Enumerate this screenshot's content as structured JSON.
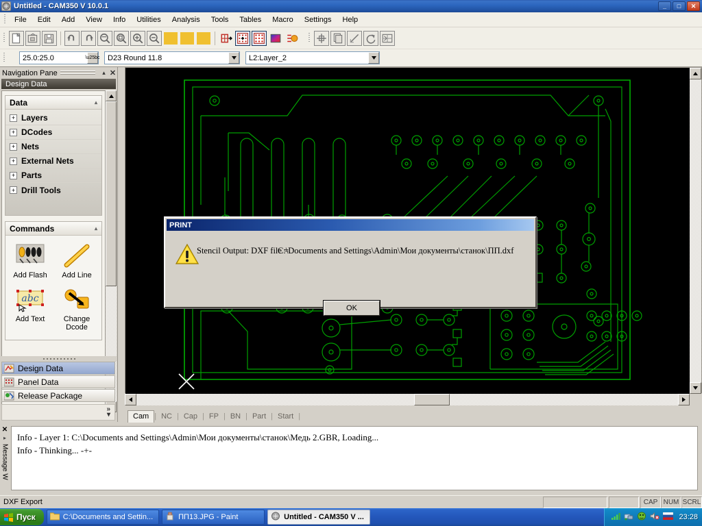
{
  "window": {
    "title": "Untitled - CAM350 V 10.0.1",
    "app_icon": "cam350-app-icon",
    "minimize": "_",
    "maximize": "□",
    "close": "✕"
  },
  "menubar": {
    "items": [
      {
        "label": "File"
      },
      {
        "label": "Edit"
      },
      {
        "label": "Add"
      },
      {
        "label": "View"
      },
      {
        "label": "Info"
      },
      {
        "label": "Utilities"
      },
      {
        "label": "Analysis"
      },
      {
        "label": "Tools"
      },
      {
        "label": "Tables"
      },
      {
        "label": "Macro"
      },
      {
        "label": "Settings"
      },
      {
        "label": "Help"
      }
    ]
  },
  "toolbar": {
    "buttons": [
      {
        "name": "new-file-icon"
      },
      {
        "name": "open-file-icon"
      },
      {
        "name": "save-file-icon"
      },
      {
        "name": "undo-icon"
      },
      {
        "name": "redo-icon"
      },
      {
        "name": "zoom-window-icon"
      },
      {
        "name": "zoom-extents-icon"
      },
      {
        "name": "zoom-in-icon"
      },
      {
        "name": "zoom-out-icon"
      },
      {
        "name": "color-swatch-1-icon"
      },
      {
        "name": "color-swatch-2-icon"
      },
      {
        "name": "color-swatch-3-icon"
      },
      {
        "name": "snap-to-grid-icon"
      },
      {
        "name": "grid-black-dots-icon"
      },
      {
        "name": "grid-red-dots-icon"
      },
      {
        "name": "color-palette-icon"
      },
      {
        "name": "layer-colors-icon"
      },
      {
        "name": "crosshair-icon"
      },
      {
        "name": "copy-layer-icon"
      },
      {
        "name": "measure-icon"
      },
      {
        "name": "rotate-icon"
      },
      {
        "name": "compare-icon"
      }
    ]
  },
  "combos": {
    "units": {
      "value": "25.0:25.0",
      "name": "units-grid-combo"
    },
    "dcode": {
      "value": "D23   Round 11.8",
      "name": "dcode-combo"
    },
    "layer": {
      "value": "L2:Layer_2",
      "name": "layer-combo"
    }
  },
  "navigation": {
    "title": "Navigation Pane",
    "auto_hide": "▴",
    "close": "✕",
    "subheader": "Design Data",
    "data_group": {
      "title": "Data",
      "collapse": "▴",
      "items": [
        {
          "label": "Layers",
          "expander": "+"
        },
        {
          "label": "DCodes",
          "expander": "+"
        },
        {
          "label": "Nets",
          "expander": "+"
        },
        {
          "label": "External Nets",
          "expander": "+"
        },
        {
          "label": "Parts",
          "expander": "+"
        },
        {
          "label": "Drill Tools",
          "expander": "+"
        }
      ]
    },
    "commands_group": {
      "title": "Commands",
      "collapse": "▴",
      "items": [
        {
          "label": "Add Flash",
          "icon": "add-flash-icon"
        },
        {
          "label": "Add Line",
          "icon": "add-line-icon"
        },
        {
          "label": "Add Text",
          "icon": "add-text-icon"
        },
        {
          "label": "Change Dcode",
          "icon": "change-dcode-icon"
        }
      ]
    },
    "pages": [
      {
        "label": "Design Data",
        "icon": "design-data-icon",
        "active": true
      },
      {
        "label": "Panel Data",
        "icon": "panel-data-icon",
        "active": false
      },
      {
        "label": "Release Package",
        "icon": "release-package-icon",
        "active": false
      }
    ],
    "more_chevron": "»",
    "more_arrow": "▾"
  },
  "canvas": {
    "background_color": "#000000",
    "trace_color": "#00a000",
    "outline_color": "#00c000",
    "origin_marker_color": "#ffffff",
    "scroll_up": "▲",
    "scroll_down": "▼",
    "scroll_left": "◄",
    "scroll_right": "►"
  },
  "cam_tabs": {
    "items": [
      {
        "label": "Cam",
        "active": true
      },
      {
        "label": "NC",
        "active": false
      },
      {
        "label": "Cap",
        "active": false
      },
      {
        "label": "FP",
        "active": false
      },
      {
        "label": "BN",
        "active": false
      },
      {
        "label": "Part",
        "active": false
      },
      {
        "label": "Start",
        "active": false
      }
    ],
    "separator": "|"
  },
  "message_window": {
    "close": "✕",
    "pin": "▸",
    "label": "Message W",
    "lines": [
      "Info - Layer 1: C:\\Documents and Settings\\Admin\\Мои документы\\станок\\Медь 2.GBR, Loading...",
      "Info - Thinking... -+-"
    ]
  },
  "statusbar": {
    "message": "DXF Export",
    "caps": "CAP",
    "num": "NUM",
    "scroll": "SCRL"
  },
  "taskbar": {
    "start_label": "Пуск",
    "tasks": [
      {
        "label": "C:\\Documents and Settin...",
        "icon": "folder-icon",
        "active": false
      },
      {
        "label": "ПП13.JPG - Paint",
        "icon": "paint-icon",
        "active": false
      },
      {
        "label": "Untitled - CAM350 V ...",
        "icon": "cam350-app-icon",
        "active": true
      }
    ],
    "tray_icons": [
      {
        "name": "signal-bars-icon"
      },
      {
        "name": "network-icon"
      },
      {
        "name": "antivirus-shield-icon"
      },
      {
        "name": "volume-mute-icon"
      },
      {
        "name": "language-flag-ru-icon"
      }
    ],
    "clock": "23:28"
  },
  "dialog": {
    "title": "PRINT",
    "icon": "warning-triangle-icon",
    "label": "Stencil Output: DXF file =",
    "path": "C:\\Documents and Settings\\Admin\\Мои документы\\станок\\ПП.dxf",
    "ok_label": "OK"
  }
}
